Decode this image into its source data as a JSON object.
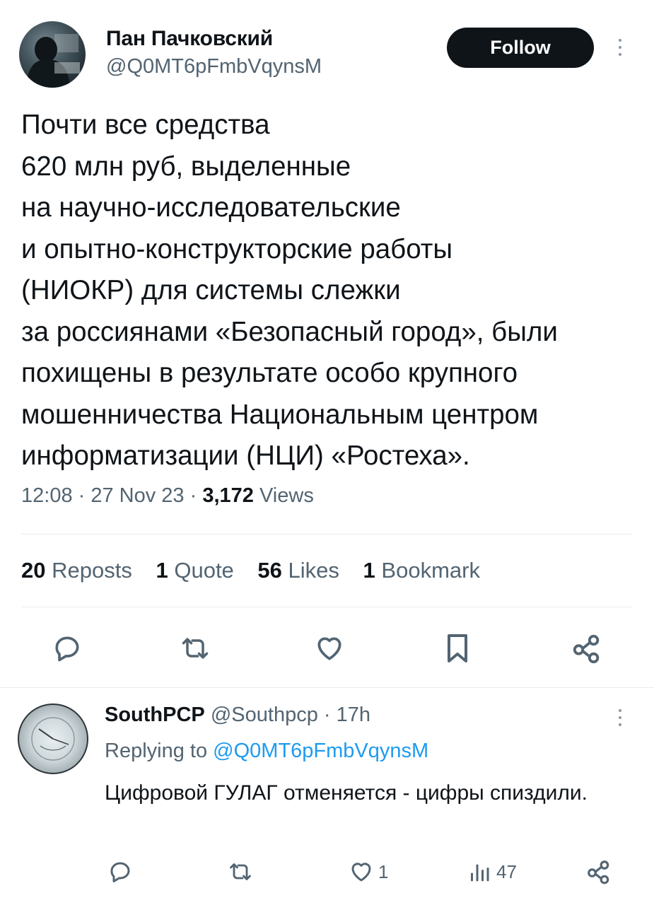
{
  "tweet": {
    "author": {
      "display_name": "Пан Пачковский",
      "handle": "@Q0MT6pFmbVqynsM"
    },
    "follow_label": "Follow",
    "text_lines": [
      "Почти все средства",
      "620 млн руб, выделенные",
      "на научно-исследовательские",
      "и опытно-конструкторские работы",
      "(НИОКР) для системы слежки",
      "за россиянами «Безопасный город», были",
      "похищены в результате особо крупного",
      "мошенничества Национальным центром",
      "информатизации (НЦИ) «Ростеха»."
    ],
    "time": "12:08",
    "date": "27 Nov 23",
    "views_count": "3,172",
    "views_label": "Views",
    "stats": {
      "reposts_count": "20",
      "reposts_label": "Reposts",
      "quote_count": "1",
      "quote_label": "Quote",
      "likes_count": "56",
      "likes_label": "Likes",
      "bookmark_count": "1",
      "bookmark_label": "Bookmark"
    },
    "actions": [
      "reply-icon",
      "repost-icon",
      "like-icon",
      "bookmark-icon",
      "share-icon"
    ]
  },
  "reply": {
    "display_name": "SouthPCP",
    "handle": "@Southpcp",
    "time_ago": "17h",
    "replying_prefix": "Replying to",
    "replying_handle": "@Q0MT6pFmbVqynsM",
    "text": "Цифровой ГУЛАГ отменяется - цифры спиздили.",
    "likes": "1",
    "views": "47"
  },
  "colors": {
    "text": "#0f1419",
    "muted": "#536471",
    "link": "#1d9bf0",
    "divider": "#e6ecf0"
  }
}
